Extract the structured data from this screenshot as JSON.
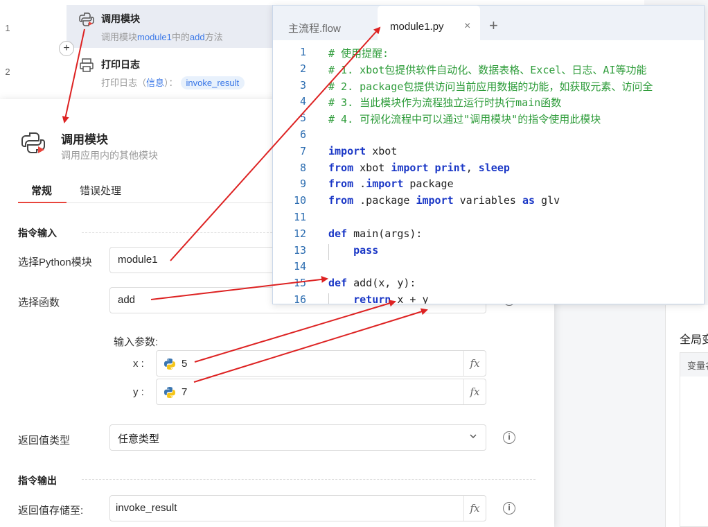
{
  "flow": {
    "rows": [
      {
        "num": "1",
        "title": "调用模块",
        "desc_pre": "调用模块",
        "desc_module": "module1",
        "desc_mid": "中的",
        "desc_func": "add",
        "desc_post": "方法"
      },
      {
        "num": "2",
        "title": "打印日志",
        "desc_pre": "打印日志（",
        "desc_level": "信息",
        "desc_mid": "）：",
        "desc_tag": "invoke_result"
      }
    ],
    "add_symbol": "+"
  },
  "dialog": {
    "title": "调用模块",
    "subtitle": "调用应用内的其他模块",
    "tabs": [
      "常规",
      "错误处理"
    ],
    "section_input": "指令输入",
    "module_label": "选择Python模块",
    "module_value": "module1",
    "func_label": "选择函数",
    "func_value": "add",
    "params_label": "输入参数:",
    "params": [
      {
        "name": "x :",
        "value": "5"
      },
      {
        "name": "y :",
        "value": "7"
      }
    ],
    "return_type_label": "返回值类型",
    "return_type_value": "任意类型",
    "section_output": "指令输出",
    "store_label": "返回值存储至:",
    "store_value": "invoke_result",
    "fx_symbol": "fx",
    "info_symbol": "i"
  },
  "editor": {
    "tabs": [
      "主流程.flow",
      "module1.py"
    ],
    "close_symbol": "×",
    "plus_symbol": "+",
    "lines": [
      {
        "n": "1",
        "cls": "cmt",
        "text": "# 使用提醒:"
      },
      {
        "n": "2",
        "cls": "cmt",
        "text": "# 1. xbot包提供软件自动化、数据表格、Excel、日志、AI等功能"
      },
      {
        "n": "3",
        "cls": "cmt",
        "text": "# 2. package包提供访问当前应用数据的功能，如获取元素、访问全"
      },
      {
        "n": "4",
        "cls": "cmt",
        "text": "# 3. 当此模块作为流程独立运行时执行main函数"
      },
      {
        "n": "5",
        "cls": "cmt",
        "text": "# 4. 可视化流程中可以通过\"调用模块\"的指令使用此模块"
      },
      {
        "n": "6",
        "cls": "",
        "text": ""
      },
      {
        "n": "7",
        "cls": "code",
        "parts": [
          [
            "kw",
            "import"
          ],
          [
            "",
            " xbot"
          ]
        ]
      },
      {
        "n": "8",
        "cls": "code",
        "parts": [
          [
            "kw",
            "from"
          ],
          [
            "",
            " xbot "
          ],
          [
            "kw",
            "import"
          ],
          [
            "",
            " "
          ],
          [
            "kw",
            "print"
          ],
          [
            "",
            ", "
          ],
          [
            "kw",
            "sleep"
          ]
        ]
      },
      {
        "n": "9",
        "cls": "code",
        "parts": [
          [
            "kw",
            "from"
          ],
          [
            "",
            " ."
          ],
          [
            "kw",
            "import"
          ],
          [
            "",
            " package"
          ]
        ]
      },
      {
        "n": "10",
        "cls": "code",
        "parts": [
          [
            "kw",
            "from"
          ],
          [
            "",
            " .package "
          ],
          [
            "kw",
            "import"
          ],
          [
            "",
            " variables "
          ],
          [
            "kw",
            "as"
          ],
          [
            "",
            " glv"
          ]
        ]
      },
      {
        "n": "11",
        "cls": "",
        "text": ""
      },
      {
        "n": "12",
        "cls": "code",
        "parts": [
          [
            "kw",
            "def"
          ],
          [
            "",
            " main(args):"
          ]
        ]
      },
      {
        "n": "13",
        "cls": "code",
        "parts": [
          [
            "",
            "    "
          ],
          [
            "kw",
            "pass"
          ]
        ]
      },
      {
        "n": "14",
        "cls": "",
        "text": ""
      },
      {
        "n": "15",
        "cls": "code",
        "parts": [
          [
            "kw",
            "def"
          ],
          [
            "",
            " add(x, y):"
          ]
        ]
      },
      {
        "n": "16",
        "cls": "code",
        "parts": [
          [
            "",
            "    "
          ],
          [
            "kw",
            "return"
          ],
          [
            "",
            " x + y"
          ]
        ]
      }
    ]
  },
  "right_panel": {
    "title": "全局变",
    "column": "变量名"
  },
  "colors": {
    "accent_red": "#e8453c",
    "link_blue": "#3b78e7",
    "comment_green": "#2e9c3a",
    "keyword_blue": "#1a37c6",
    "arrow_red": "#dd2222"
  }
}
